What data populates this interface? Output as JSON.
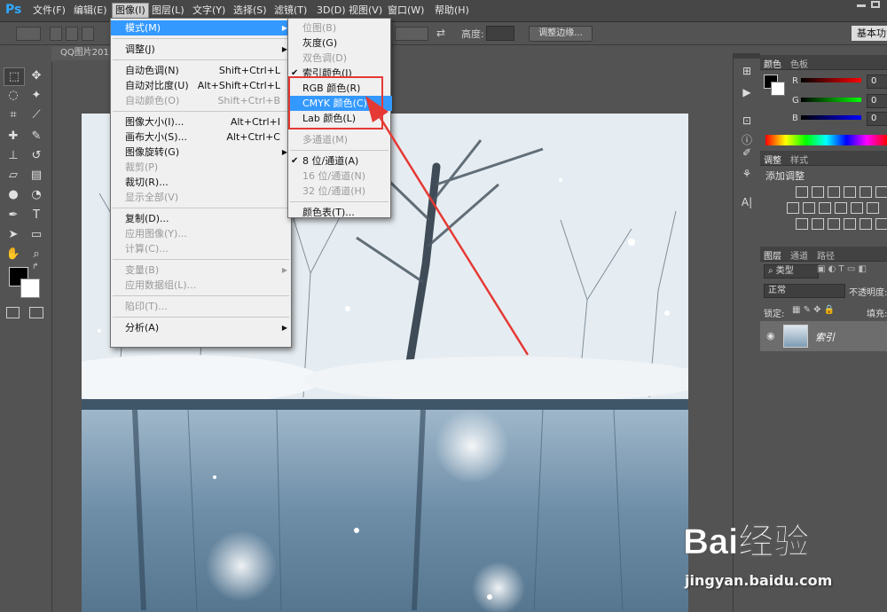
{
  "app": {
    "logo": "Ps"
  },
  "menubar": {
    "items": [
      "文件(F)",
      "编辑(E)",
      "图像(I)",
      "图层(L)",
      "文字(Y)",
      "选择(S)",
      "滤镜(T)",
      "3D(D)",
      "视图(V)",
      "窗口(W)",
      "帮助(H)"
    ],
    "active": "图像(I)"
  },
  "optbar": {
    "height_label": "高度:",
    "refine_edge": "调整边缘...",
    "workspace": "基本功能"
  },
  "document": {
    "tab_title": "QQ图片201"
  },
  "image_menu": {
    "items": [
      {
        "label": "模式(M)",
        "submenu": true,
        "highlighted": true
      },
      {
        "sep": true
      },
      {
        "label": "调整(J)",
        "submenu": true
      },
      {
        "sep": true
      },
      {
        "label": "自动色调(N)",
        "shortcut": "Shift+Ctrl+L"
      },
      {
        "label": "自动对比度(U)",
        "shortcut": "Alt+Shift+Ctrl+L"
      },
      {
        "label": "自动颜色(O)",
        "shortcut": "Shift+Ctrl+B",
        "disabled": true
      },
      {
        "sep": true
      },
      {
        "label": "图像大小(I)...",
        "shortcut": "Alt+Ctrl+I"
      },
      {
        "label": "画布大小(S)...",
        "shortcut": "Alt+Ctrl+C"
      },
      {
        "label": "图像旋转(G)",
        "submenu": true
      },
      {
        "label": "裁剪(P)",
        "disabled": true
      },
      {
        "label": "裁切(R)..."
      },
      {
        "label": "显示全部(V)",
        "disabled": true
      },
      {
        "sep": true
      },
      {
        "label": "复制(D)..."
      },
      {
        "label": "应用图像(Y)...",
        "disabled": true
      },
      {
        "label": "计算(C)...",
        "disabled": true
      },
      {
        "sep": true
      },
      {
        "label": "变量(B)",
        "submenu": true,
        "disabled": true
      },
      {
        "label": "应用数据组(L)...",
        "disabled": true
      },
      {
        "sep": true
      },
      {
        "label": "陷印(T)...",
        "disabled": true
      },
      {
        "sep": true
      },
      {
        "label": "分析(A)",
        "submenu": true
      }
    ]
  },
  "mode_menu": {
    "items": [
      {
        "label": "位图(B)",
        "disabled": true
      },
      {
        "label": "灰度(G)"
      },
      {
        "label": "双色调(D)",
        "disabled": true
      },
      {
        "label": "索引颜色(I)",
        "checked": true
      },
      {
        "label": "RGB 颜色(R)"
      },
      {
        "label": "CMYK 颜色(C)",
        "highlighted": true
      },
      {
        "label": "Lab 颜色(L)"
      },
      {
        "sep": true
      },
      {
        "label": "多通道(M)",
        "disabled": true
      },
      {
        "sep": true
      },
      {
        "label": "8 位/通道(A)",
        "checked": true
      },
      {
        "label": "16 位/通道(N)",
        "disabled": true
      },
      {
        "label": "32 位/通道(H)",
        "disabled": true
      },
      {
        "sep": true
      },
      {
        "label": "颜色表(T)..."
      }
    ]
  },
  "color_panel": {
    "tabs": [
      "颜色",
      "色板"
    ],
    "channels": [
      {
        "label": "R",
        "value": "0"
      },
      {
        "label": "G",
        "value": "0"
      },
      {
        "label": "B",
        "value": "0"
      }
    ]
  },
  "adjust_panel": {
    "tabs": [
      "调整",
      "样式"
    ],
    "title": "添加调整"
  },
  "layers_panel": {
    "tabs": [
      "图层",
      "通道",
      "路径"
    ],
    "kind_filter": "类型",
    "blend_mode": "正常",
    "opacity_label": "不透明度:",
    "lock_label": "锁定:",
    "fill_label": "填充:",
    "layer_name": "索引"
  },
  "watermark": {
    "brand": "Bai经验",
    "url": "jingyan.baidu.com"
  },
  "colors": {
    "accent": "#3399ff",
    "annotation": "#e53935",
    "ps_blue": "#31a8ff"
  }
}
